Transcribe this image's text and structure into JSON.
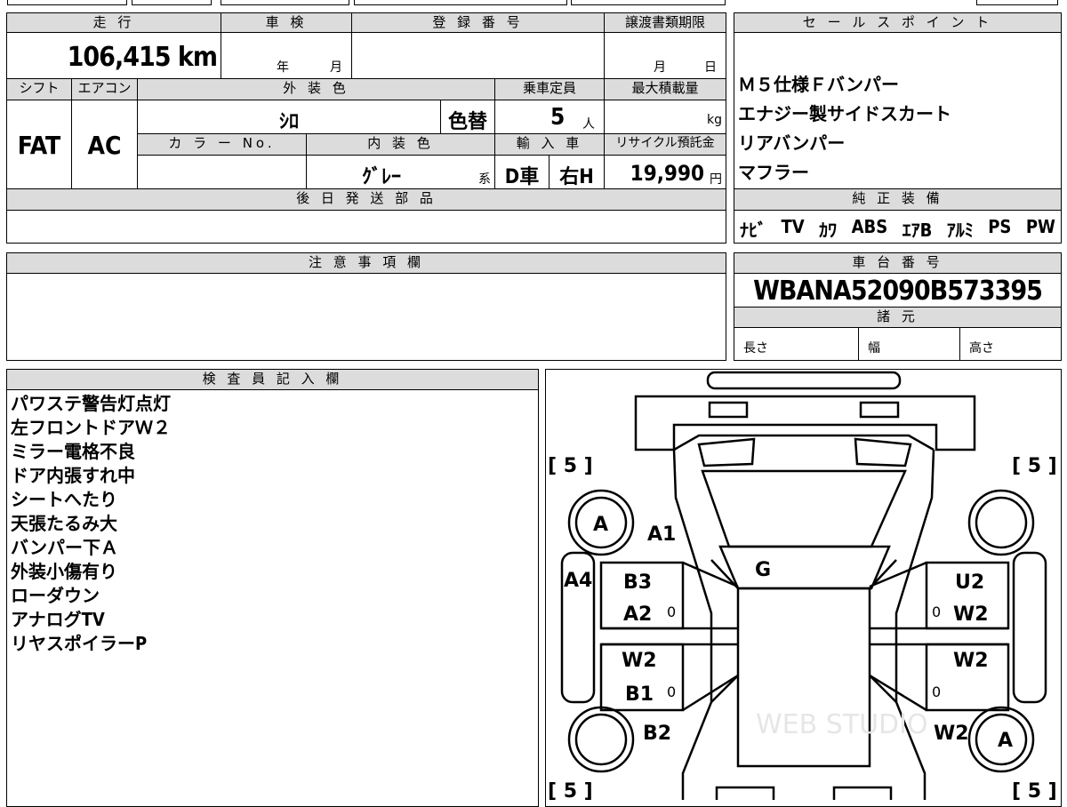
{
  "mileage": {
    "header": "走 行",
    "value": "106,415 km"
  },
  "shaken": {
    "header": "車 検",
    "year_unit": "年",
    "month_unit": "月"
  },
  "registration": {
    "header": "登 録 番 号"
  },
  "transfer_deadline": {
    "header": "譲渡書類期限",
    "month_unit": "月",
    "day_unit": "日"
  },
  "shift": {
    "header": "シフト",
    "value": "FAT"
  },
  "aircon": {
    "header": "エアコン",
    "value": "AC"
  },
  "exterior_color": {
    "header": "外 装 色",
    "value": "ｼﾛ",
    "repaint": "色替"
  },
  "capacity": {
    "header": "乗車定員",
    "value": "5",
    "unit": "人"
  },
  "max_load": {
    "header": "最大積載量",
    "unit": "kg"
  },
  "color_no": {
    "header": "カ ラ ー No."
  },
  "interior_color": {
    "header": "内 装 色",
    "value": "ｸﾞﾚｰ",
    "suffix": "系"
  },
  "import": {
    "header": "輸 入 車",
    "dealer": "D車",
    "handle": "右H"
  },
  "recycle": {
    "header": "リサイクル預託金",
    "value": "19,990",
    "unit": "円"
  },
  "later_parts": {
    "header": "後 日 発 送 部 品"
  },
  "notes": {
    "header": "注 意 事 項 欄"
  },
  "sales_points": {
    "header": "セ ー ル ス ポ イ ン ト",
    "items": [
      "Ｍ５仕様Ｆバンパー",
      "エナジー製サイドスカート",
      "リアバンパー",
      "マフラー"
    ]
  },
  "equipment": {
    "header": "純 正 装 備",
    "items": [
      "ﾅﾋﾞ",
      "TV",
      "ｶﾜ",
      "ABS",
      "ｴｱB",
      "ｱﾙﾐ",
      "PS",
      "PW"
    ]
  },
  "chassis": {
    "header": "車 台 番 号",
    "value": "WBANA52090B573395"
  },
  "specs": {
    "header": "諸 元",
    "length": "長さ",
    "width": "幅",
    "height": "高さ"
  },
  "inspector": {
    "header": "検 査 員 記 入 欄",
    "lines": [
      "パワステ警告灯点灯",
      "左フロントドアＷ２",
      "ミラー電格不良",
      "ドア内張すれ中",
      "シートへたり",
      "天張たるみ大",
      "バンパー下Ａ",
      "外装小傷有り",
      "ローダウン",
      "アナログTV",
      "リヤスポイラーP"
    ]
  },
  "diagram": {
    "tire_fl": "[ 5 ]",
    "tire_fr": "[ 5 ]",
    "tire_rl": "[ 5 ]",
    "tire_rr": "[ 5 ]",
    "wheel_fl": "A",
    "wheel_rr": "A",
    "a1": "A1",
    "g": "G",
    "a4": "A4",
    "b3": "B3",
    "a2": "A2",
    "zero1": "0",
    "u2": "U2",
    "zero2": "0",
    "w2_r1": "W2",
    "w2_l2": "W2",
    "w2_r2": "W2",
    "b1": "B1",
    "zero3": "0",
    "zero4": "0",
    "b2": "B2",
    "w2_r3": "W2",
    "watermark": "WEB STUDIO"
  }
}
